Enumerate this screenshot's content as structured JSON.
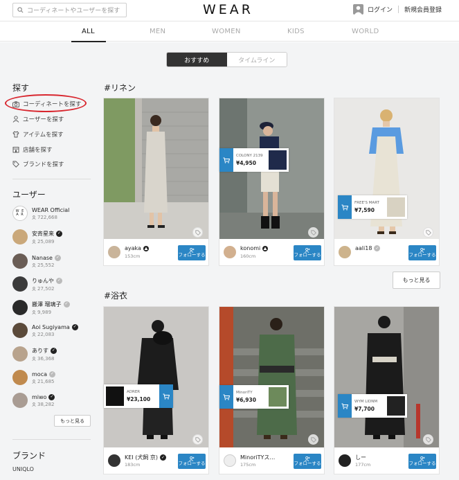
{
  "header": {
    "search_placeholder": "コーディネートやユーザーを探す",
    "logo": "WEAR",
    "login": "ログイン",
    "register": "新規会員登録"
  },
  "nav": {
    "tabs": [
      {
        "label": "ALL",
        "active": true
      },
      {
        "label": "MEN",
        "active": false
      },
      {
        "label": "WOMEN",
        "active": false
      },
      {
        "label": "KIDS",
        "active": false
      },
      {
        "label": "WORLD",
        "active": false
      }
    ]
  },
  "toggle": {
    "recommended": "おすすめ",
    "timeline": "タイムライン"
  },
  "sidebar": {
    "search_heading": "探す",
    "links": [
      {
        "label": "コーディネートを探す",
        "icon": "camera-icon"
      },
      {
        "label": "ユーザーを探す",
        "icon": "person-icon"
      },
      {
        "label": "アイテムを探す",
        "icon": "shirt-icon"
      },
      {
        "label": "店舗を探す",
        "icon": "store-icon"
      },
      {
        "label": "ブランドを探す",
        "icon": "tag-icon"
      }
    ],
    "users_heading": "ユーザー",
    "users": [
      {
        "name": "WEAR Official",
        "followers": "722,668",
        "badge": "none"
      },
      {
        "name": "安斉星来",
        "followers": "25,089",
        "badge": "black"
      },
      {
        "name": "Nanase",
        "followers": "25,552",
        "badge": "grey"
      },
      {
        "name": "りゅんや",
        "followers": "27,502",
        "badge": "grey"
      },
      {
        "name": "搬澤 瑠璃子",
        "followers": "9,989",
        "badge": "grey"
      },
      {
        "name": "Aoi Sugiyama",
        "followers": "22,083",
        "badge": "black"
      },
      {
        "name": "ありす",
        "followers": "36,368",
        "badge": "black"
      },
      {
        "name": "moca",
        "followers": "21,685",
        "badge": "grey"
      },
      {
        "name": "miwo",
        "followers": "38,282",
        "badge": "black"
      }
    ],
    "more": "もっと見る",
    "brand_heading": "ブランド",
    "brand_first": "UNIQLO"
  },
  "sections": [
    {
      "title": "#リネン",
      "cards": [
        {
          "user": "ayaka",
          "height": "153cm",
          "follow": "フォローする",
          "price_tag": null
        },
        {
          "user": "konomi",
          "height": "160cm",
          "follow": "フォローする",
          "price_tag": {
            "shop": "COLONY 2139",
            "price": "¥4,950"
          }
        },
        {
          "user": "aali18",
          "height": "",
          "follow": "フォローする",
          "price_tag": {
            "shop": "FREE'S MART",
            "price": "¥7,590"
          }
        }
      ],
      "more": "もっと見る"
    },
    {
      "title": "#浴衣",
      "cards": [
        {
          "user": "KEI (犬飼 京)",
          "height": "183cm",
          "follow": "フォローする",
          "price_tag": {
            "shop": "ADRER",
            "price": "¥23,100"
          }
        },
        {
          "user": "MinoriTYス…",
          "height": "175cm",
          "follow": "フォローする",
          "price_tag": {
            "shop": "MinoriTY",
            "price": "¥6,930"
          }
        },
        {
          "user": "しー",
          "height": "177cm",
          "follow": "フォローする",
          "price_tag": {
            "shop": "WYM LIDNM",
            "price": "¥7,700"
          }
        }
      ]
    }
  ]
}
